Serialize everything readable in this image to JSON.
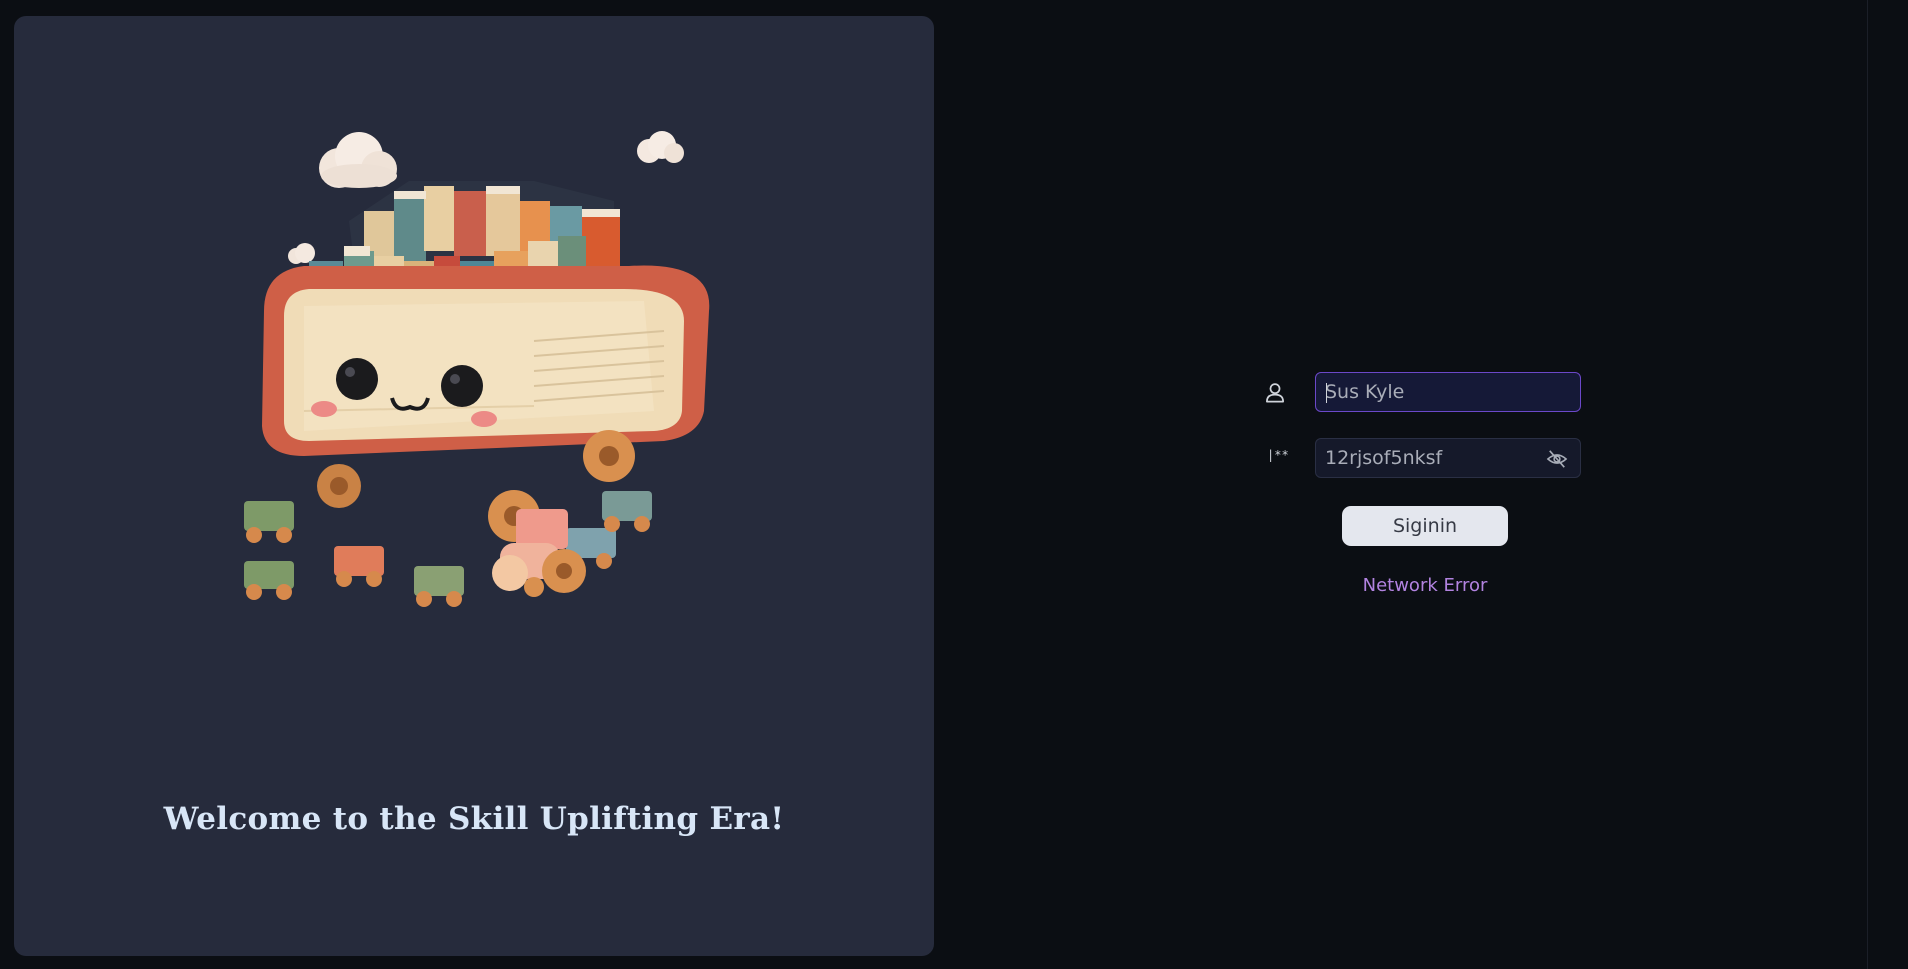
{
  "welcome": {
    "title": "Welcome to the Skill Uplifting Era!"
  },
  "login": {
    "username_icon": "user-icon",
    "username_value": "Sus Kyle",
    "password_icon": "password-icon",
    "password_icon_text": "|**",
    "password_value": "12rjsof5nksf",
    "visibility_icon": "eye-off-icon",
    "signin_label": "Siginin",
    "error_message": "Network Error"
  },
  "colors": {
    "background": "#0b0e13",
    "panel": "#262b3c",
    "title": "#d8e6f7",
    "focus_border": "#6b48c9",
    "button_bg": "#e4e7ee",
    "error": "#b283e0"
  }
}
